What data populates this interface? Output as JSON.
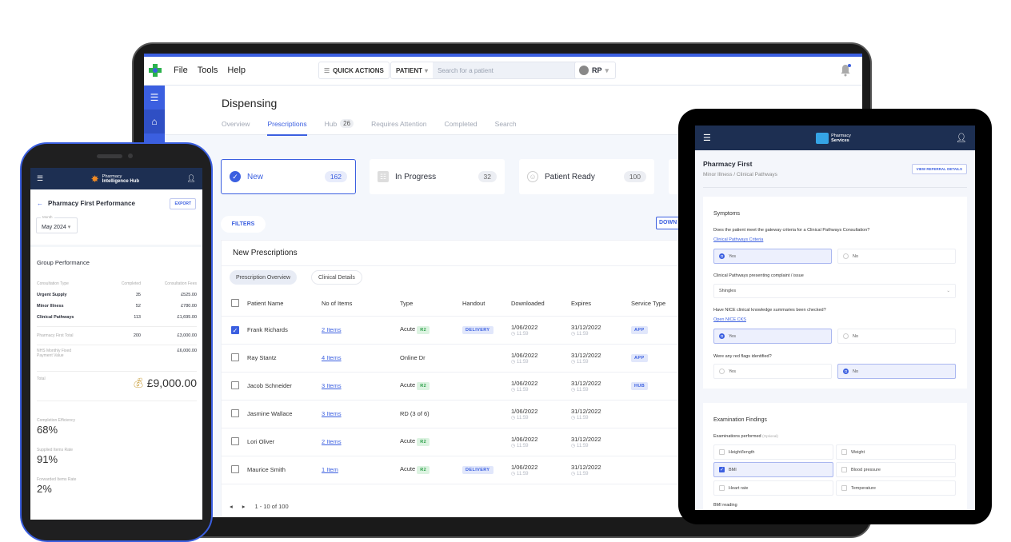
{
  "desktop": {
    "menu": [
      "File",
      "Tools",
      "Help"
    ],
    "quick_actions_label": "QUICK ACTIONS",
    "patient_select_label": "PATIENT",
    "search_placeholder": "Search for a patient",
    "user_initials": "RP",
    "page_title": "Dispensing",
    "tabs": [
      {
        "label": "Overview"
      },
      {
        "label": "Prescriptions",
        "active": true
      },
      {
        "label": "Hub",
        "badge": "26"
      },
      {
        "label": "Requires Attention"
      },
      {
        "label": "Completed"
      },
      {
        "label": "Search"
      }
    ],
    "status_cards": [
      {
        "label": "New",
        "count": "162",
        "icon": "verified-badge-icon"
      },
      {
        "label": "In Progress",
        "count": "32",
        "icon": "list-icon"
      },
      {
        "label": "Patient Ready",
        "count": "100",
        "icon": "person-icon"
      }
    ],
    "filters_label": "FILTERS",
    "download_label": "DOWN",
    "panel_title": "New Prescriptions",
    "panel_tabs": [
      "Prescription Overview",
      "Clinical Details"
    ],
    "columns": [
      "Patient Name",
      "No of Items",
      "Type",
      "Handout",
      "Downloaded",
      "Expires",
      "Service Type"
    ],
    "rows": [
      {
        "checked": true,
        "name": "Frank Richards",
        "items": "2 Items",
        "type": "Acute",
        "type_badge": "R2",
        "handout": "DELIVERY",
        "downloaded": "1/06/2022",
        "downloaded_time": "11:59",
        "expires": "31/12/2022",
        "expires_time": "11:59",
        "service": "APP"
      },
      {
        "checked": false,
        "name": "Ray Stantz",
        "items": "4 Items",
        "type": "Online Dr",
        "type_badge": "",
        "handout": "",
        "downloaded": "1/06/2022",
        "downloaded_time": "11:59",
        "expires": "31/12/2022",
        "expires_time": "11:59",
        "service": "APP"
      },
      {
        "checked": false,
        "name": "Jacob Schneider",
        "items": "3 Items",
        "type": "Acute",
        "type_badge": "R2",
        "handout": "",
        "downloaded": "1/06/2022",
        "downloaded_time": "11:59",
        "expires": "31/12/2022",
        "expires_time": "11:59",
        "service": "HUB"
      },
      {
        "checked": false,
        "name": "Jasmine Wallace",
        "items": "3 Items",
        "type": "RD (3 of 6)",
        "type_badge": "",
        "handout": "",
        "downloaded": "1/06/2022",
        "downloaded_time": "11:59",
        "expires": "31/12/2022",
        "expires_time": "11:59",
        "service": ""
      },
      {
        "checked": false,
        "name": "Lori Oliver",
        "items": "2 Items",
        "type": "Acute",
        "type_badge": "R2",
        "handout": "",
        "downloaded": "1/06/2022",
        "downloaded_time": "11:59",
        "expires": "31/12/2022",
        "expires_time": "11:59",
        "service": ""
      },
      {
        "checked": false,
        "name": "Maurice Smith",
        "items": "1 Item",
        "type": "Acute",
        "type_badge": "R2",
        "handout": "DELIVERY",
        "downloaded": "1/06/2022",
        "downloaded_time": "11:59",
        "expires": "31/12/2022",
        "expires_time": "11:59",
        "service": ""
      }
    ],
    "pagination": "1 - 10 of 100"
  },
  "phone": {
    "app_name_line1": "Pharmacy",
    "app_name_line2": "Intelligence Hub",
    "title": "Pharmacy First Performance",
    "export_label": "EXPORT",
    "month_label": "Month",
    "month_value": "May 2024",
    "group_title": "Group Performance",
    "table_headers": [
      "Consultation Type",
      "Completed",
      "Consultation Fees"
    ],
    "table_rows": [
      {
        "type": "Urgent Supply",
        "completed": "35",
        "fees": "£525.00"
      },
      {
        "type": "Minor Illness",
        "completed": "52",
        "fees": "£780.00"
      },
      {
        "type": "Clinical Pathways",
        "completed": "113",
        "fees": "£1,695.00"
      }
    ],
    "pf_total_label": "Pharmacy First Total",
    "pf_total_completed": "200",
    "pf_total_fees": "£3,000.00",
    "nhs_label_1": "NHS Monthly Fixed",
    "nhs_label_2": "Payment Value",
    "nhs_value": "£6,000.00",
    "total_label": "Total",
    "total_value": "£9,000.00",
    "metrics": [
      {
        "label": "Completion Efficiency",
        "value": "68%"
      },
      {
        "label": "Supplied Items Rate",
        "value": "91%"
      },
      {
        "label": "Forwarded Items Rate",
        "value": "2%"
      }
    ]
  },
  "tablet": {
    "app_name_line1": "Pharmacy",
    "app_name_line2": "Services",
    "title": "Pharmacy First",
    "subtitle": "Minor Illness / Clinical Pathways",
    "view_referral_label": "VIEW REFERRAL DETAILS",
    "symptoms": {
      "heading": "Symptoms",
      "q1": "Does the patient meet the gateway criteria for a Clinical Pathways Consultation?",
      "q1_link": "Clinical Pathways Criteria",
      "q1_answer": "Yes",
      "q2": "Clinical Pathways presenting complaint / issue",
      "q2_value": "Shingles",
      "q3": "Have NICE clinical knowledge summaries been checked?",
      "q3_link": "Open NICE CKS",
      "q3_answer": "Yes",
      "q4": "Were any red flags identified?",
      "q4_answer": "No",
      "yes_label": "Yes",
      "no_label": "No"
    },
    "exam": {
      "heading": "Examination Findings",
      "label": "Examinations performed",
      "optional": "(Optional)",
      "options": [
        {
          "label": "Height/length",
          "checked": false
        },
        {
          "label": "Weight",
          "checked": false
        },
        {
          "label": "BMI",
          "checked": true
        },
        {
          "label": "Blood pressure",
          "checked": false
        },
        {
          "label": "Heart rate",
          "checked": false
        },
        {
          "label": "Temperature",
          "checked": false
        }
      ],
      "bmi_reading_label": "BMI reading"
    }
  }
}
